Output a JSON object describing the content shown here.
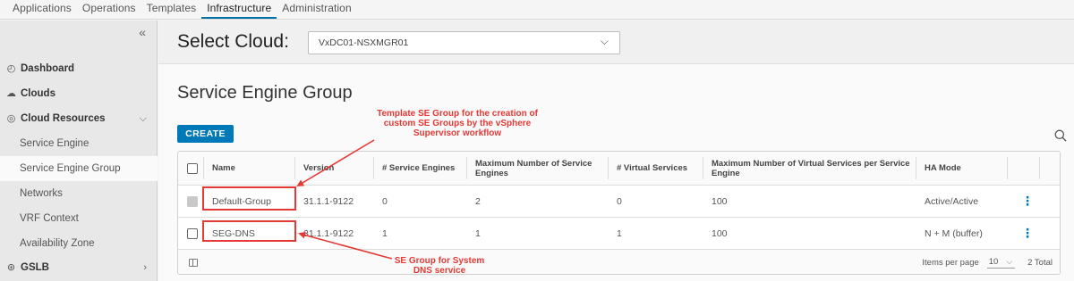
{
  "topnav": {
    "tabs": [
      {
        "label": "Applications"
      },
      {
        "label": "Operations"
      },
      {
        "label": "Templates"
      },
      {
        "label": "Infrastructure"
      },
      {
        "label": "Administration"
      }
    ],
    "active_tab": "Infrastructure"
  },
  "sidebar": {
    "collapse_glyph": "«",
    "items": [
      {
        "label": "Dashboard",
        "icon": "dashboard-icon"
      },
      {
        "label": "Clouds",
        "icon": "cloud-icon"
      },
      {
        "label": "Cloud Resources",
        "icon": "cloud-resources-icon",
        "expanded": true
      },
      {
        "label": "Service Engine"
      },
      {
        "label": "Service Engine Group",
        "selected": true
      },
      {
        "label": "Networks"
      },
      {
        "label": "VRF Context"
      },
      {
        "label": "Availability Zone"
      },
      {
        "label": "GSLB",
        "icon": "gslb-icon"
      }
    ]
  },
  "cloud_selector": {
    "label": "Select Cloud:",
    "value": "VxDC01-NSXMGR01"
  },
  "page": {
    "title": "Service Engine Group",
    "create_label": "CREATE"
  },
  "table": {
    "columns": [
      "Name",
      "Version",
      "# Service Engines",
      "Maximum Number of Service Engines",
      "# Virtual Services",
      "Maximum Number of Virtual Services per Service Engine",
      "HA Mode"
    ],
    "rows": [
      {
        "name": "Default-Group",
        "version": "31.1.1-9122",
        "service_engines": "0",
        "max_service_engines": "2",
        "virtual_services": "0",
        "max_vs_per_se": "100",
        "ha_mode": "Active/Active",
        "checkbox_disabled": true
      },
      {
        "name": "SEG-DNS",
        "version": "31.1.1-9122",
        "service_engines": "1",
        "max_service_engines": "1",
        "virtual_services": "1",
        "max_vs_per_se": "100",
        "ha_mode": "N + M (buffer)",
        "checkbox_disabled": false
      }
    ],
    "footer": {
      "items_per_page_label": "Items per page",
      "items_per_page_value": "10",
      "total": "2 Total"
    }
  },
  "annotations": {
    "callout_1": "Template SE Group for the creation of custom SE Groups by the vSphere Supervisor workflow",
    "callout_2": "SE Group for System DNS service",
    "color": "#e53935"
  },
  "colors": {
    "accent": "#0079b8",
    "annotation": "#e53935"
  }
}
